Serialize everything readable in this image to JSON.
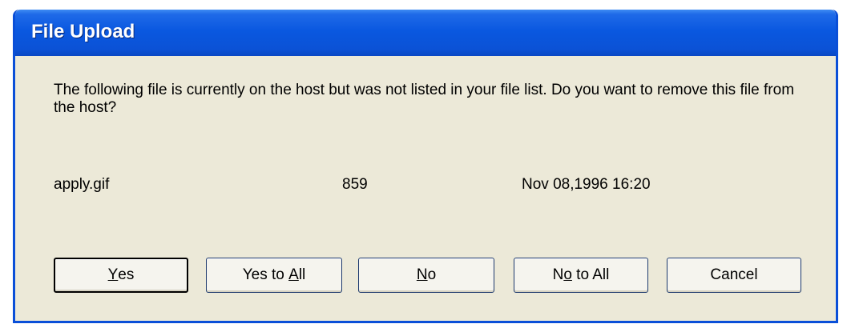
{
  "window": {
    "title": "File Upload"
  },
  "message": {
    "text": "The following file is currently on the host but was not listed in your file list.  Do you want to remove this file from the host?"
  },
  "file": {
    "name": "apply.gif",
    "size": "859",
    "date": "Nov 08,1996 16:20"
  },
  "buttons": {
    "yes": {
      "pre": "",
      "acc": "Y",
      "post": "es"
    },
    "yes_all": {
      "pre": "Yes to ",
      "acc": "A",
      "post": "ll"
    },
    "no": {
      "pre": "",
      "acc": "N",
      "post": "o"
    },
    "no_all": {
      "pre": "N",
      "acc": "o",
      "post": " to All"
    },
    "cancel": {
      "pre": "Cancel",
      "acc": "",
      "post": ""
    }
  },
  "colors": {
    "title_bar": "#0a58e0",
    "dialog_bg": "#ece9d8",
    "frame": "#0a4fd8"
  }
}
